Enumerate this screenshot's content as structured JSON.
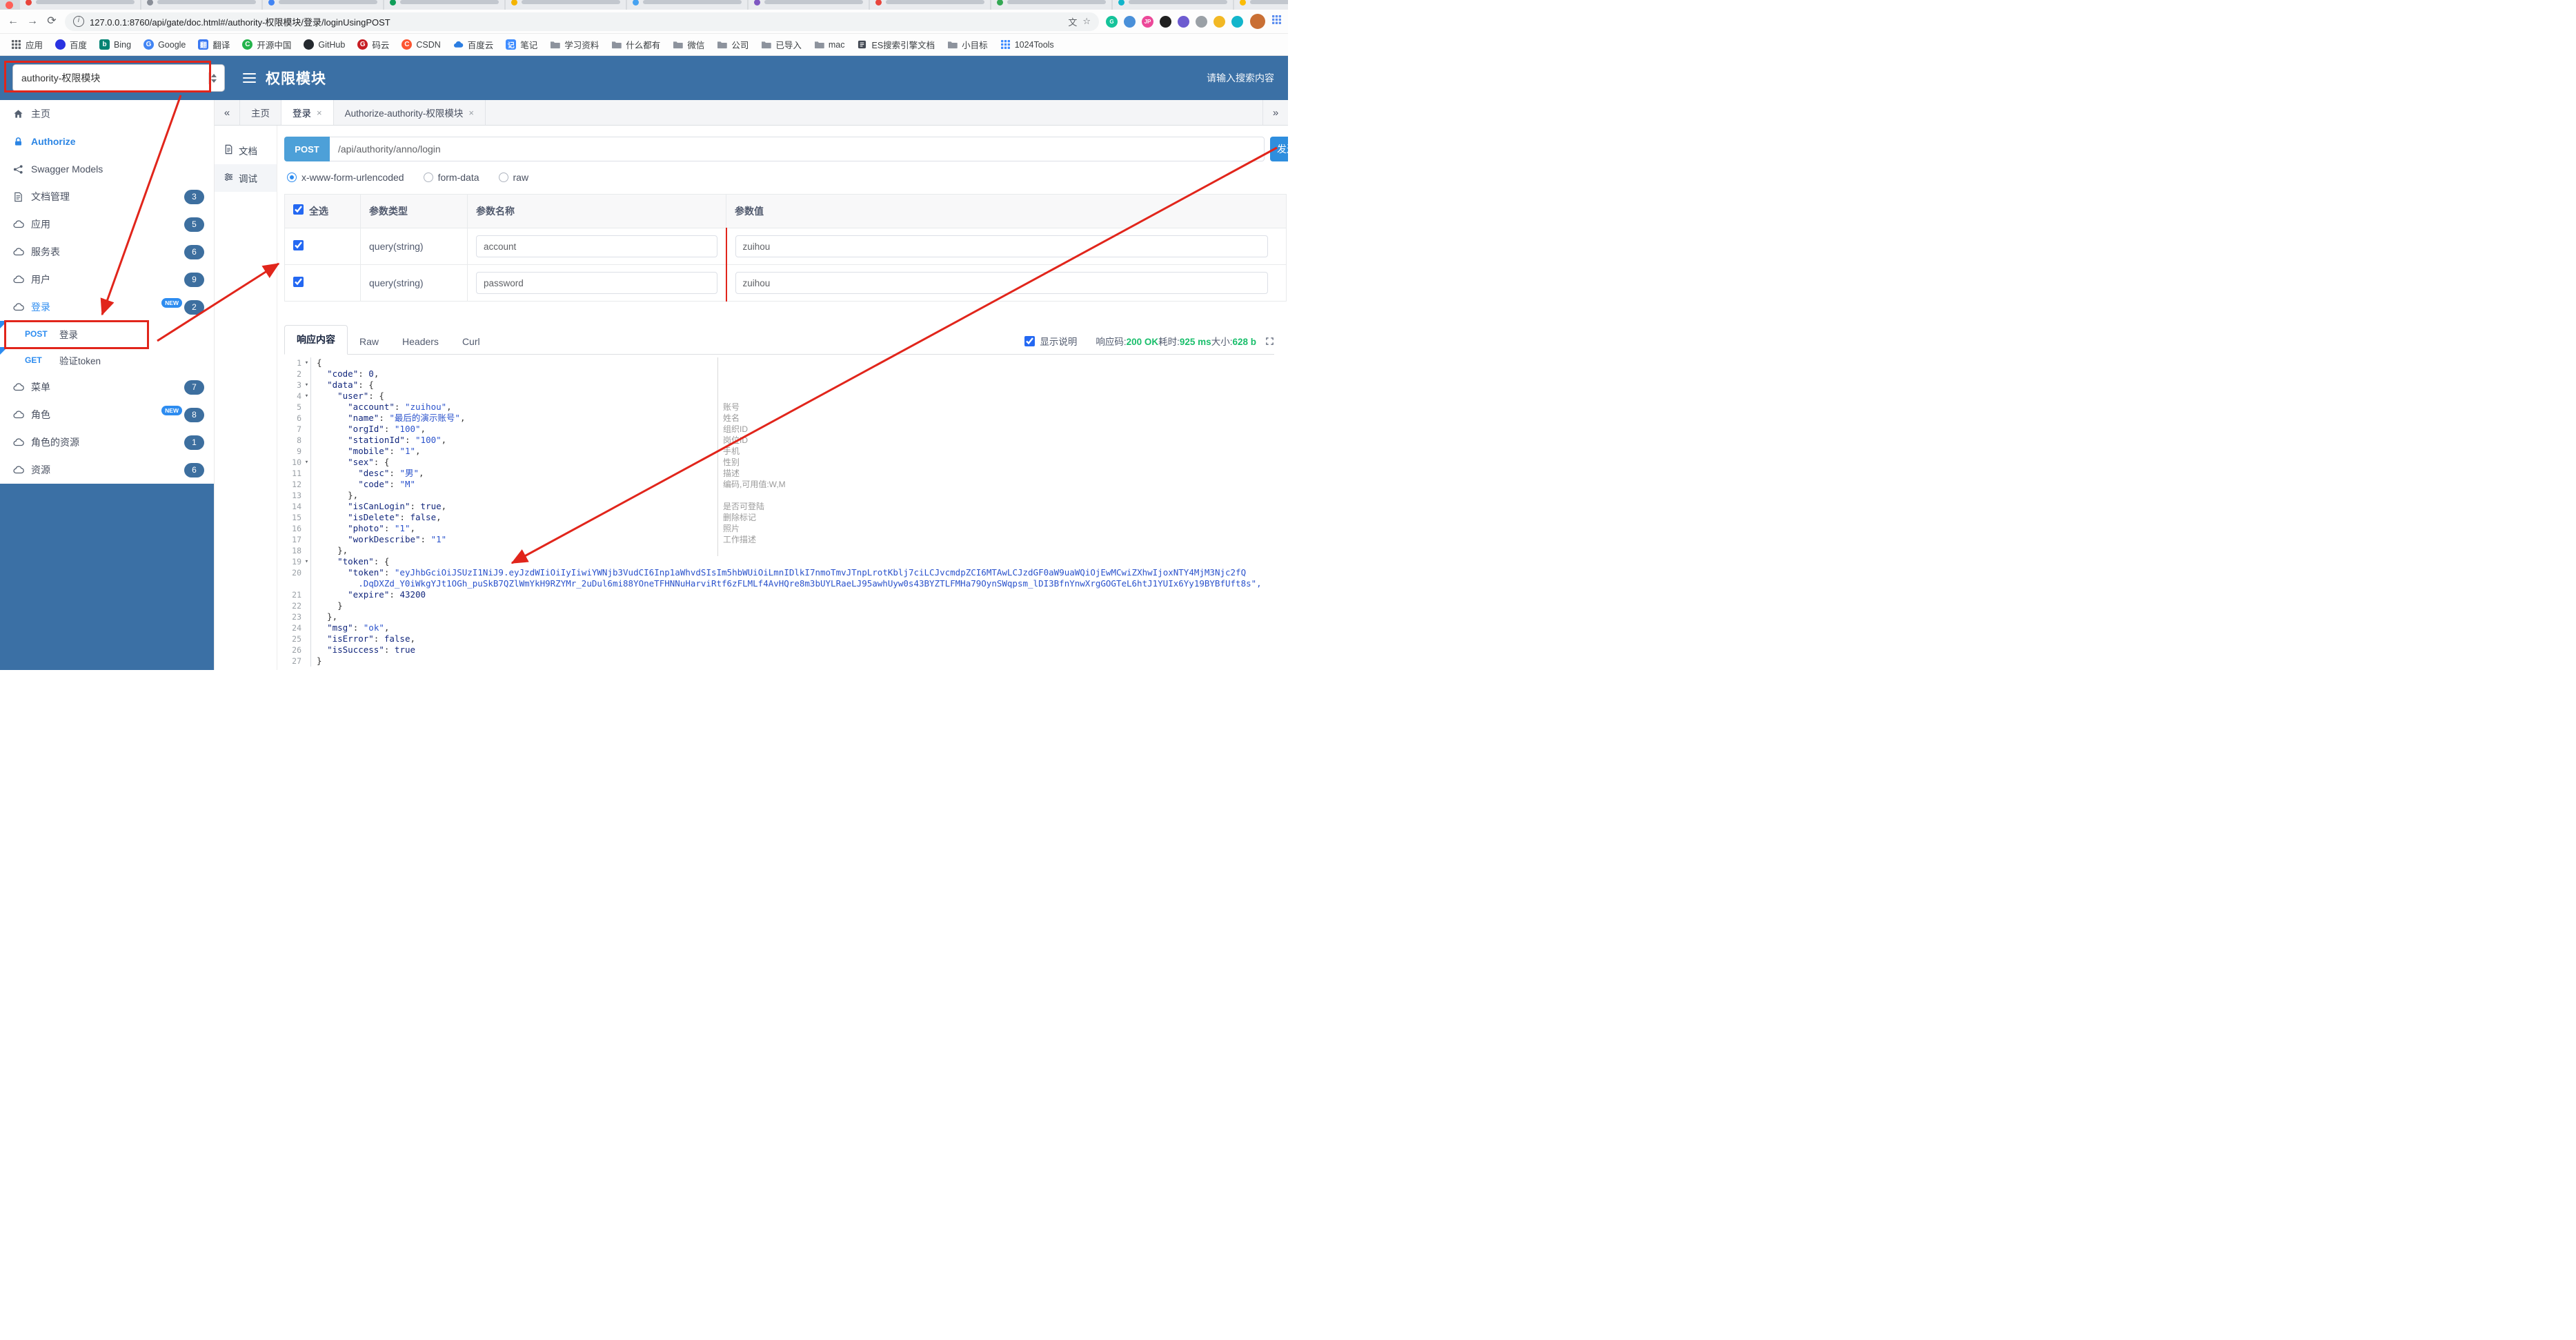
{
  "icons": {
    "collapse": "«",
    "expand": "»",
    "close": "×",
    "caret": "▾",
    "star": "☆",
    "info": "i",
    "back": "←",
    "forward": "→",
    "reload": "⟳",
    "translate": "文"
  },
  "browser": {
    "url": "127.0.0.1:8760/api/gate/doc.html#/authority-权限模块/登录/loginUsingPOST",
    "tab_favicons": [
      "#e8453c",
      "#8a8f98",
      "#4285f4",
      "#0f9d58",
      "#f4b400",
      "#46a2f1",
      "#7e57c2",
      "#e8453c",
      "#34a853",
      "#12b5cb",
      "#fbbc05"
    ],
    "extensions": [
      {
        "name": "extension-icon-1",
        "color": "#15c39a",
        "glyph": "G"
      },
      {
        "name": "extension-icon-2",
        "color": "#4a90d9",
        "glyph": ""
      },
      {
        "name": "extension-icon-3",
        "color": "#ec4899",
        "glyph": "JP"
      },
      {
        "name": "extension-icon-4",
        "color": "#1f1f1f",
        "glyph": ""
      },
      {
        "name": "extension-icon-5",
        "color": "#6d5bd0",
        "glyph": ""
      },
      {
        "name": "extension-icon-6",
        "color": "#9aa0a6",
        "glyph": ""
      },
      {
        "name": "extension-icon-7",
        "color": "#f2b824",
        "glyph": ""
      },
      {
        "name": "extension-icon-8",
        "color": "#12b5cb",
        "glyph": ""
      }
    ],
    "bookmarks": [
      {
        "label": "应用",
        "icon": {
          "shape": "grid",
          "color": "#5f6368"
        }
      },
      {
        "label": "百度",
        "icon": {
          "shape": "circle",
          "color": "#2932e1"
        }
      },
      {
        "label": "Bing",
        "icon": {
          "shape": "square",
          "color": "#008373",
          "glyph": "b"
        }
      },
      {
        "label": "Google",
        "icon": {
          "shape": "circle",
          "color": "#4285f4",
          "glyph": "G"
        }
      },
      {
        "label": "翻译",
        "icon": {
          "shape": "square",
          "color": "#3a78f2",
          "glyph": "翻"
        }
      },
      {
        "label": "开源中国",
        "icon": {
          "shape": "circle",
          "color": "#24b34b",
          "glyph": "C"
        }
      },
      {
        "label": "GitHub",
        "icon": {
          "shape": "circle",
          "color": "#24292e"
        }
      },
      {
        "label": "码云",
        "icon": {
          "shape": "circle",
          "color": "#c71d23",
          "glyph": "G"
        }
      },
      {
        "label": "CSDN",
        "icon": {
          "shape": "circle",
          "color": "#fc5531",
          "glyph": "C"
        }
      },
      {
        "label": "百度云",
        "icon": {
          "shape": "cloud",
          "color": "#2b7de1"
        }
      },
      {
        "label": "笔记",
        "icon": {
          "shape": "square",
          "color": "#3f8cff",
          "glyph": "记"
        }
      },
      {
        "label": "学习资料",
        "icon": {
          "shape": "folder"
        }
      },
      {
        "label": "什么都有",
        "icon": {
          "shape": "folder"
        }
      },
      {
        "label": "微信",
        "icon": {
          "shape": "folder"
        }
      },
      {
        "label": "公司",
        "icon": {
          "shape": "folder"
        }
      },
      {
        "label": "已导入",
        "icon": {
          "shape": "folder"
        }
      },
      {
        "label": "mac",
        "icon": {
          "shape": "folder"
        }
      },
      {
        "label": "ES搜索引擎文档",
        "icon": {
          "shape": "book",
          "color": "#444a54"
        }
      },
      {
        "label": "小目标",
        "icon": {
          "shape": "folder"
        }
      },
      {
        "label": "1024Tools",
        "icon": {
          "shape": "grid",
          "color": "#3f8cff"
        }
      }
    ]
  },
  "header": {
    "module_select": "authority-权限模块",
    "title": "权限模块",
    "search_placeholder": "请输入搜索内容"
  },
  "sidebar": {
    "items": [
      {
        "icon": "home",
        "label": "主页"
      },
      {
        "icon": "lock",
        "label": "Authorize",
        "accent": true
      },
      {
        "icon": "nodes",
        "label": "Swagger Models"
      },
      {
        "icon": "doc",
        "label": "文档管理",
        "badge": "3"
      },
      {
        "icon": "cloud",
        "label": "应用",
        "badge": "5"
      },
      {
        "icon": "cloud",
        "label": "服务表",
        "badge": "6"
      },
      {
        "icon": "cloud",
        "label": "用户",
        "badge": "9"
      },
      {
        "icon": "cloud",
        "label": "登录",
        "badge": "2",
        "new": true,
        "active": true
      },
      {
        "method": "POST",
        "label": "登录",
        "flag": true
      },
      {
        "method": "GET",
        "label": "验证token",
        "flag": true
      },
      {
        "icon": "cloud",
        "label": "菜单",
        "badge": "7"
      },
      {
        "icon": "cloud",
        "label": "角色",
        "badge": "8",
        "new": true
      },
      {
        "icon": "cloud",
        "label": "角色的资源",
        "badge": "1"
      },
      {
        "icon": "cloud",
        "label": "资源",
        "badge": "6"
      }
    ]
  },
  "doc_tabs": [
    {
      "label": "主页"
    },
    {
      "label": "登录",
      "closable": true,
      "active": true
    },
    {
      "label": "Authorize-authority-权限模块",
      "closable": true
    }
  ],
  "doc_nav": {
    "doc_label": "文档",
    "debug_label": "调试"
  },
  "request": {
    "method": "POST",
    "url": "/api/authority/anno/login",
    "send_label": "发送",
    "content_types": [
      "x-www-form-urlencoded",
      "form-data",
      "raw"
    ],
    "selected_content_type": "x-www-form-urlencoded"
  },
  "params_table": {
    "headers": [
      "全选",
      "参数类型",
      "参数名称",
      "参数值"
    ],
    "rows": [
      {
        "checked": true,
        "type": "query(string)",
        "name": "account",
        "value": "zuihou"
      },
      {
        "checked": true,
        "type": "query(string)",
        "name": "password",
        "value": "zuihou"
      }
    ]
  },
  "response": {
    "tabs": [
      "响应内容",
      "Raw",
      "Headers",
      "Curl"
    ],
    "active_tab": "响应内容",
    "show_desc_label": "显示说明",
    "meta": [
      {
        "label": "响应码:",
        "value": "200 OK"
      },
      {
        "label": "耗时:",
        "value": "925 ms"
      },
      {
        "label": "大小:",
        "value": "628 b"
      }
    ]
  },
  "code": {
    "lines": [
      {
        "n": "1",
        "f": 1,
        "t": "{"
      },
      {
        "n": "2",
        "t": "  \"code\": 0,"
      },
      {
        "n": "3",
        "f": 1,
        "t": "  \"data\": {"
      },
      {
        "n": "4",
        "f": 1,
        "t": "    \"user\": {"
      },
      {
        "n": "5",
        "t": "      \"account\": \"zuihou\","
      },
      {
        "n": "6",
        "t": "      \"name\": \"最后的演示账号\","
      },
      {
        "n": "7",
        "t": "      \"orgId\": \"100\","
      },
      {
        "n": "8",
        "t": "      \"stationId\": \"100\","
      },
      {
        "n": "9",
        "t": "      \"mobile\": \"1\","
      },
      {
        "n": "10",
        "f": 1,
        "t": "      \"sex\": {"
      },
      {
        "n": "11",
        "t": "        \"desc\": \"男\","
      },
      {
        "n": "12",
        "t": "        \"code\": \"M\""
      },
      {
        "n": "13",
        "t": "      },"
      },
      {
        "n": "14",
        "t": "      \"isCanLogin\": true,"
      },
      {
        "n": "15",
        "t": "      \"isDelete\": false,"
      },
      {
        "n": "16",
        "t": "      \"photo\": \"1\","
      },
      {
        "n": "17",
        "t": "      \"workDescribe\": \"1\""
      },
      {
        "n": "18",
        "t": "    },"
      },
      {
        "n": "19",
        "f": 1,
        "t": "    \"token\": {"
      },
      {
        "n": "20",
        "t": "      \"token\": \"eyJhbGciOiJSUzI1NiJ9.eyJzdWIiOiIyIiwiYWNjb3VudCI6Inp1aWhvdSIsIm5hbWUiOiLmnIDlkI7nmoTmvJTnpLrotKblj7ciLCJvcmdpZCI6MTAwLCJzdGF0aW9uaWQiOjEwMCwiZXhwIjoxNTY4MjM3Njc2fQ"
      },
      {
        "n": "",
        "c": 1,
        "t": "        .DqDXZd_Y0iWkgYJt1OGh_puSkB7QZlWmYkH9RZYMr_2uDul6mi88YOneTFHNNuHarviRtf6zFLMLf4AvHQre8m3bUYLRaeLJ95awhUyw0s43BYZTLFMHa79OynSWqpsm_lDI3BfnYnwXrgGOGTeL6htJ1YUIx6Yy19BYBfUft8s\","
      },
      {
        "n": "21",
        "t": "      \"expire\": 43200"
      },
      {
        "n": "22",
        "t": "    }"
      },
      {
        "n": "23",
        "t": "  },"
      },
      {
        "n": "24",
        "t": "  \"msg\": \"ok\","
      },
      {
        "n": "25",
        "t": "  \"isError\": false,"
      },
      {
        "n": "26",
        "t": "  \"isSuccess\": true"
      },
      {
        "n": "27",
        "t": "}"
      }
    ],
    "annotations": {
      "5": "账号",
      "6": "姓名",
      "7": "组织ID",
      "8": "岗位ID",
      "9": "手机",
      "10": "性别",
      "11": "描述",
      "12": "编码,可用值:W,M",
      "14": "是否可登陆",
      "15": "删除标记",
      "16": "照片",
      "17": "工作描述"
    }
  }
}
